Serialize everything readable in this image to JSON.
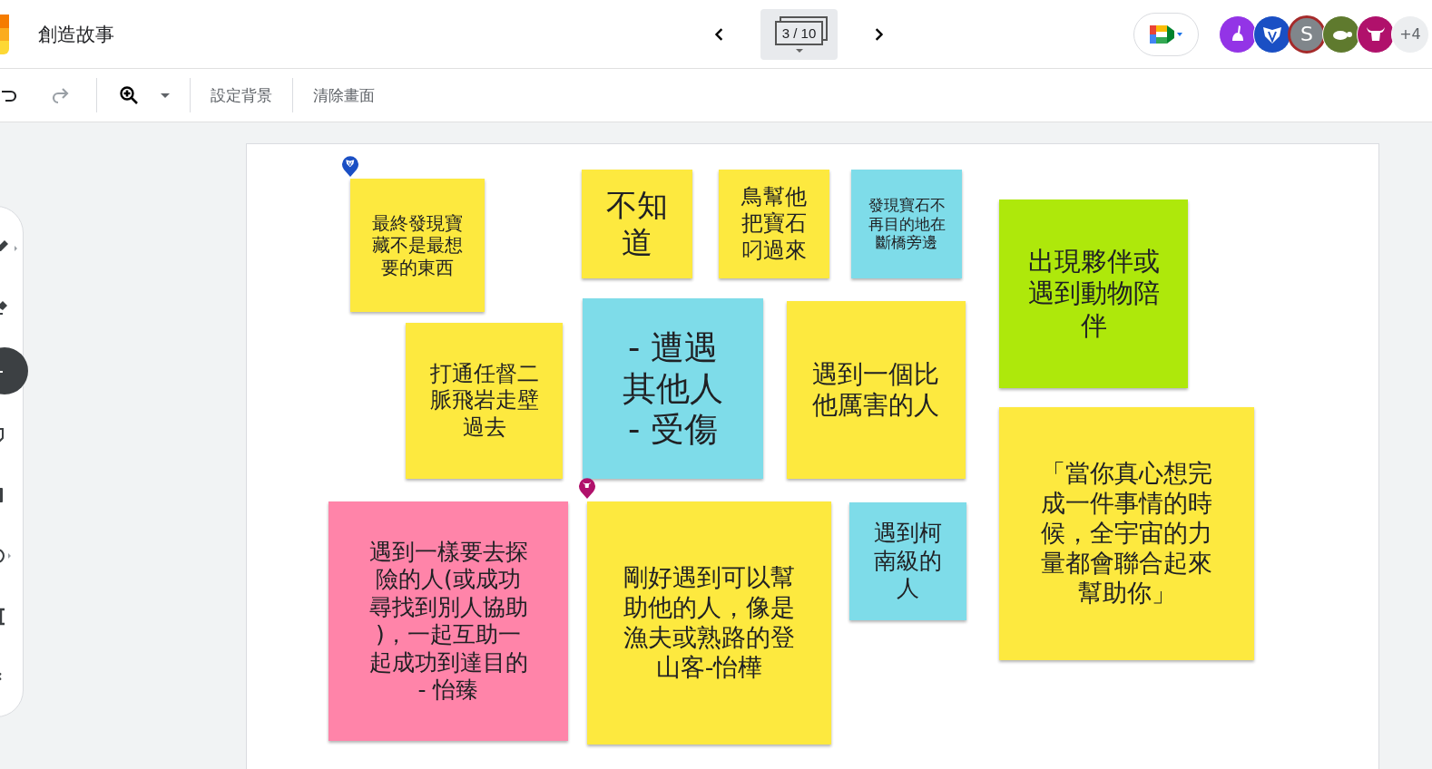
{
  "header": {
    "title": "創造故事",
    "slide_counter": "3 / 10",
    "avatars": [
      {
        "kind": "rabbit",
        "color": "#9334e6"
      },
      {
        "kind": "badger",
        "color": "#1a4fc4"
      },
      {
        "kind": "letter",
        "letter": "S",
        "color": "#80868b"
      },
      {
        "kind": "turtle",
        "color": "#5f7a2e"
      },
      {
        "kind": "bull",
        "color": "#b0116b"
      }
    ],
    "more_count": "+4"
  },
  "toolbar": {
    "actions": [
      "設定背景",
      "清除畫面"
    ]
  },
  "tools": [
    {
      "kind": "pen",
      "selected": false
    },
    {
      "kind": "eraser",
      "selected": false
    },
    {
      "kind": "select",
      "selected": true
    },
    {
      "kind": "note",
      "selected": false
    },
    {
      "kind": "image",
      "selected": false
    },
    {
      "kind": "shape",
      "selected": false
    },
    {
      "kind": "textbox",
      "selected": false
    },
    {
      "kind": "laser",
      "selected": false
    }
  ],
  "pins": [
    {
      "kind": "badger",
      "color": "#1a4fc4"
    },
    {
      "kind": "bull",
      "color": "#b0116b"
    }
  ],
  "notes": [
    {
      "text": "最終發現寶藏不是最想要的東西",
      "color": "#fde93f"
    },
    {
      "text": "不知道",
      "color": "#fde93f"
    },
    {
      "text": "鳥幫他把寶石叼過來",
      "color": "#fde93f"
    },
    {
      "text": "發現寶石不再目的地在斷橋旁邊",
      "color": "#7edce9"
    },
    {
      "text": "出現夥伴或遇到動物陪伴",
      "color": "#aee80b"
    },
    {
      "text": "打通任督二脈飛岩走壁過去",
      "color": "#fde93f"
    },
    {
      "text": "- 遭遇其他人- 受傷",
      "color": "#7edce9"
    },
    {
      "text": "遇到一個比他厲害的人",
      "color": "#fde93f"
    },
    {
      "text": "「當你真心想完成一件事情的時候，全宇宙的力量都會聯合起來幫助你」",
      "color": "#fde93f"
    },
    {
      "text": "遇到一樣要去探險的人(或成功尋找到別人協助)，一起互助一起成功到達目的　- 怡臻",
      "color": "#ff84a9"
    },
    {
      "text": "剛好遇到可以幫助他的人，像是漁夫或熟路的登山客-怡樺",
      "color": "#fde93f"
    },
    {
      "text": "遇到柯南級的人",
      "color": "#7edce9"
    }
  ]
}
